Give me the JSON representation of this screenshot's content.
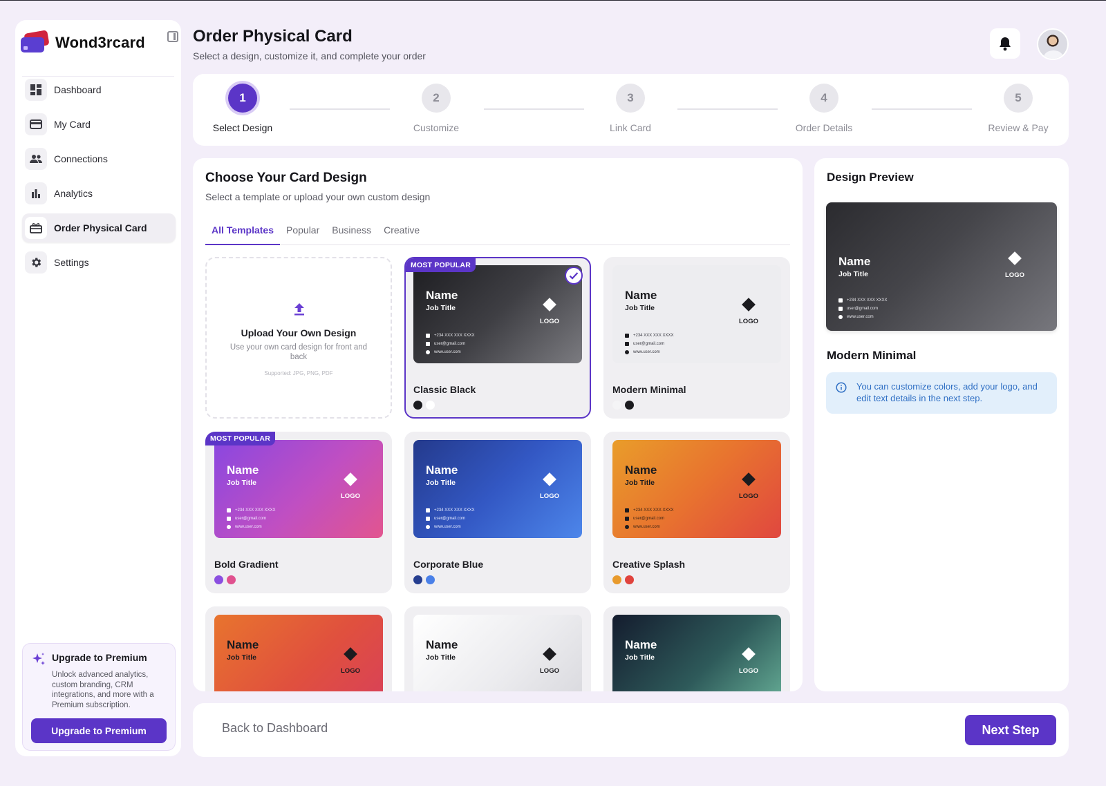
{
  "sidebar": {
    "brand": "Wond3rcard",
    "items": [
      {
        "label": "Dashboard",
        "icon": "dashboard-icon",
        "active": false
      },
      {
        "label": "My Card",
        "icon": "card-icon",
        "active": false
      },
      {
        "label": "Connections",
        "icon": "people-icon",
        "active": false
      },
      {
        "label": "Analytics",
        "icon": "bar-chart-icon",
        "active": false
      },
      {
        "label": "Order Physical Card",
        "icon": "gift-card-icon",
        "active": true
      },
      {
        "label": "Settings",
        "icon": "gear-icon",
        "active": false
      }
    ],
    "upgrade": {
      "title": "Upgrade to Premium",
      "text": "Unlock advanced analytics, custom branding, CRM integrations, and more with a Premium subscription.",
      "button": "Upgrade to Premium"
    }
  },
  "header": {
    "title": "Order Physical Card",
    "subtitle": "Select a design, customize it, and complete your order"
  },
  "stepper": {
    "current": 1,
    "steps": [
      {
        "number": "1",
        "label": "Select Design"
      },
      {
        "number": "2",
        "label": "Customize"
      },
      {
        "number": "3",
        "label": "Link Card"
      },
      {
        "number": "4",
        "label": "Order Details"
      },
      {
        "number": "5",
        "label": "Review & Pay"
      }
    ]
  },
  "main": {
    "title": "Choose Your Card Design",
    "subtitle": "Select a template or upload your own custom design",
    "tabs": [
      {
        "label": "All Templates",
        "active": true
      },
      {
        "label": "Popular",
        "active": false
      },
      {
        "label": "Business",
        "active": false
      },
      {
        "label": "Creative",
        "active": false
      }
    ],
    "upload": {
      "title": "Upload Your Own Design",
      "text": "Use your own card design for front and back",
      "supported": "Supported: JPG, PNG, PDF"
    },
    "card_face": {
      "name": "Name",
      "job_title": "Job Title",
      "logo": "LOGO",
      "phone": "+234 XXX XXX XXXX",
      "email": "user@gmail.com",
      "website": "www.user.com"
    },
    "templates": [
      {
        "name": "Classic Black",
        "badge": "MOST POPULAR",
        "selected": true,
        "swatches": [
          "#1b1b1f",
          "#ffffff"
        ]
      },
      {
        "name": "Modern Minimal",
        "badge": "",
        "selected": false,
        "swatches": [
          "#f4f4f6",
          "#1b1b1f"
        ]
      },
      {
        "name": "Bold Gradient",
        "badge": "MOST POPULAR",
        "selected": false,
        "swatches": [
          "#8b4fe0",
          "#e0518f"
        ]
      },
      {
        "name": "Corporate Blue",
        "badge": "",
        "selected": false,
        "swatches": [
          "#253d8f",
          "#4a80e8"
        ]
      },
      {
        "name": "Creative Splash",
        "badge": "",
        "selected": false,
        "swatches": [
          "#e89a2c",
          "#e0433d"
        ]
      }
    ]
  },
  "preview": {
    "title": "Design Preview",
    "design_name": "Modern Minimal",
    "info": "You can customize colors, add your logo, and edit text details in the next step."
  },
  "footer": {
    "back": "Back to Dashboard",
    "next": "Next Step"
  },
  "colors": {
    "accent": "#5b35c7",
    "background": "#f3eef9",
    "info_text": "#2f6fc4"
  }
}
